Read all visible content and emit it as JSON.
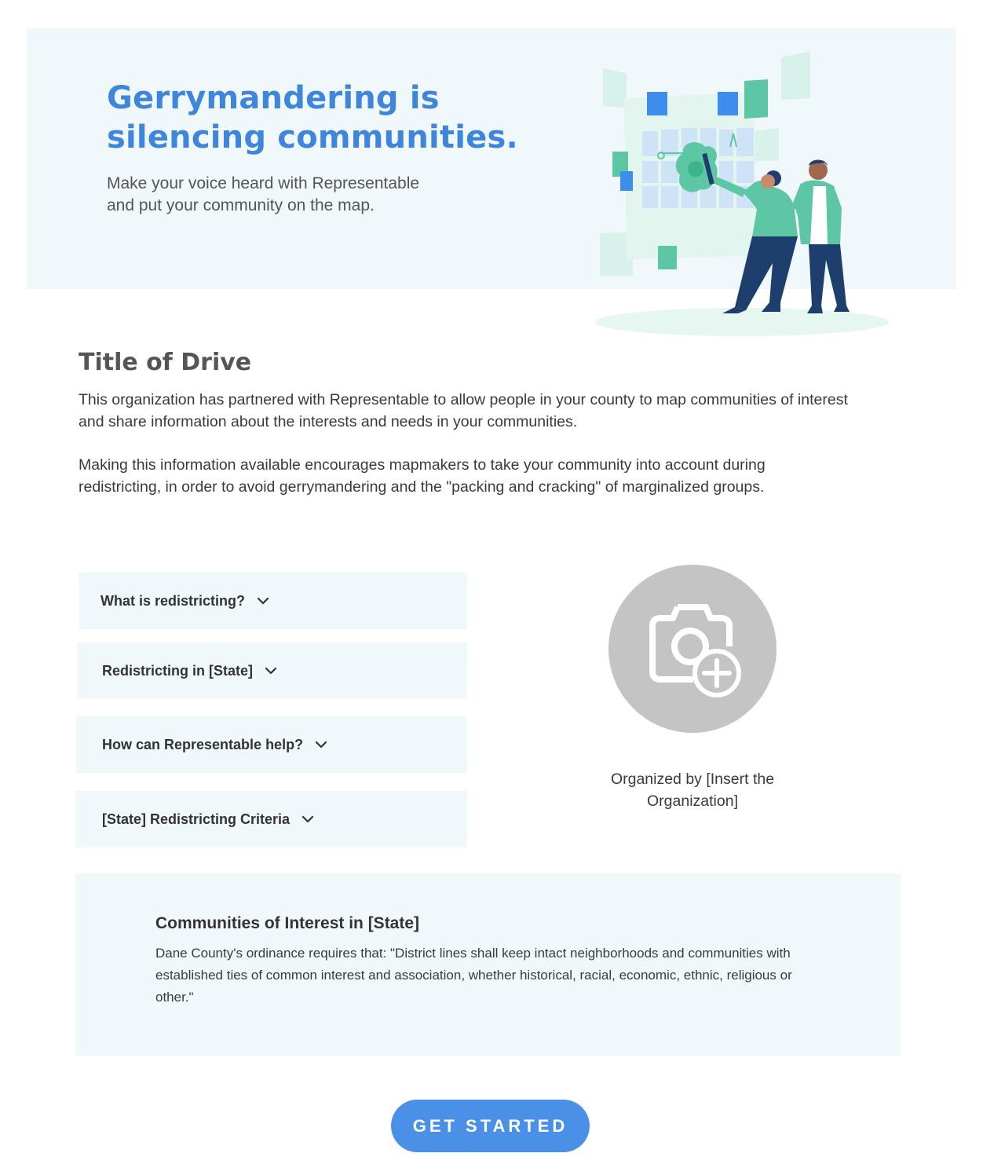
{
  "hero": {
    "title_line1": "Gerrymandering is",
    "title_line2": "silencing communities.",
    "subtitle_line1": "Make your voice heard with Representable",
    "subtitle_line2": "and put your community on the map.",
    "illustration": "people-drawing-community-map-illustration"
  },
  "drive": {
    "title": "Title of Drive",
    "paragraph1": "This organization has partnered with Representable to allow people in your county to map communities of interest and share information about the interests and needs in your communities.",
    "paragraph2": "Making this information available encourages mapmakers to take your community into account during redistricting, in order to avoid gerrymandering and the \"packing and cracking\" of marginalized groups."
  },
  "accordion": [
    {
      "label": "What is redistricting?",
      "icon": "chevron-down-icon"
    },
    {
      "label": "Redistricting in [State]",
      "icon": "chevron-down-icon"
    },
    {
      "label": "How can Representable help?",
      "icon": "chevron-down-icon"
    },
    {
      "label": "[State] Redistricting Criteria",
      "icon": "chevron-down-icon"
    }
  ],
  "organizer": {
    "avatar_icon": "add-photo-camera-icon",
    "line1": "Organized by [Insert the",
    "line2": "Organization]"
  },
  "coi": {
    "title": "Communities of Interest in [State]",
    "text": "Dane County's ordinance requires that: \"District lines shall keep intact neighborhoods and communities with established ties of common interest and association, whether historical, racial, economic, ethnic, religious or other.\""
  },
  "cta": {
    "label": "GET STARTED"
  },
  "colors": {
    "accent": "#3d86dc",
    "button": "#4a90e6",
    "panel": "#f1f8fb",
    "teal": "#5cc6a5",
    "navy": "#1e3f6e"
  }
}
